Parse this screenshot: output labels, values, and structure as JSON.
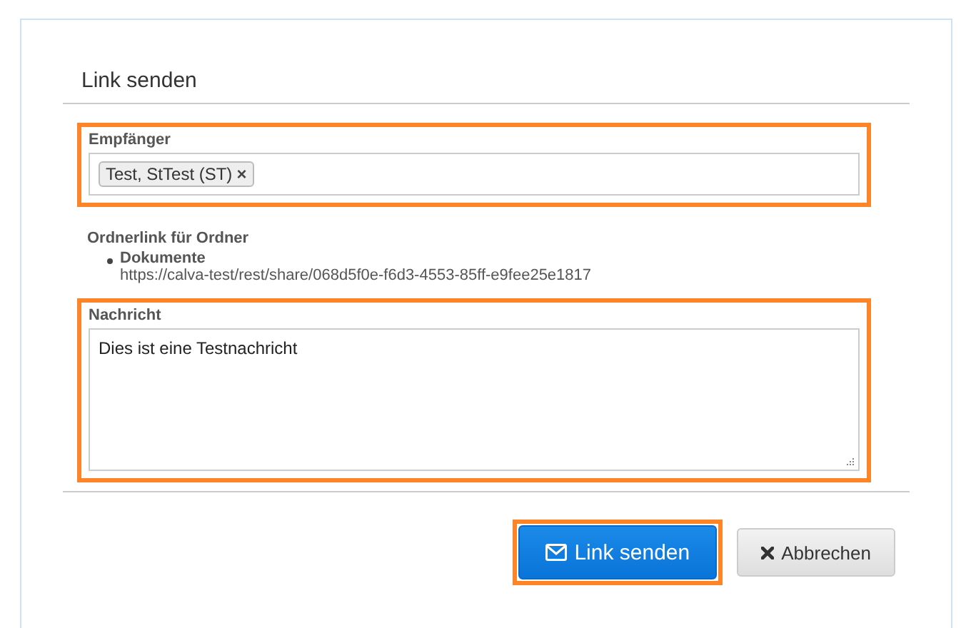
{
  "dialog": {
    "title": "Link senden"
  },
  "recipients": {
    "label": "Empfänger",
    "highlighted": true,
    "tags": [
      {
        "text": "Test, StTest (ST)",
        "remove": "×"
      }
    ]
  },
  "folder_link": {
    "heading": "Ordnerlink für Ordner",
    "items": [
      {
        "name": "Dokumente",
        "url": "https://calva-test/rest/share/068d5f0e-f6d3-4553-85ff-e9fee25e1817"
      }
    ]
  },
  "message": {
    "label": "Nachricht",
    "highlighted": true,
    "value": "Dies ist eine Testnachricht"
  },
  "buttons": [
    {
      "kind": "primary",
      "label": "Link senden",
      "highlighted": true
    },
    {
      "kind": "cancel",
      "label": "Abbrechen",
      "highlighted": false
    }
  ]
}
